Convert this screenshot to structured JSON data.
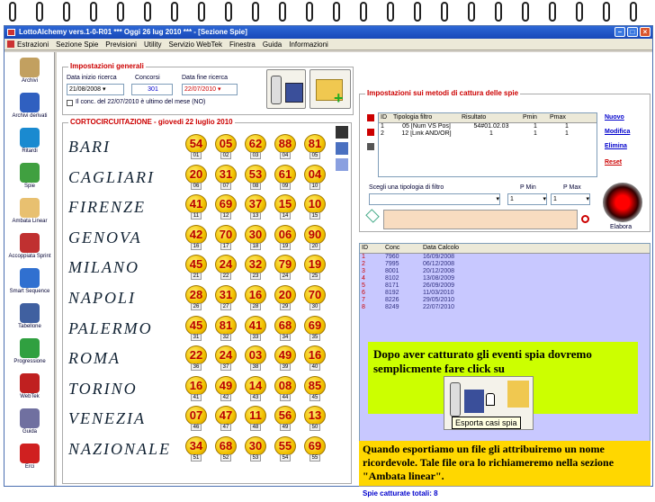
{
  "window": {
    "title": "LottoAlchemy vers.1-0-R01  ***  Oggi 26 lug 2010  ***  - [Sezione Spie]"
  },
  "menu": [
    "Estrazioni",
    "Sezione Spie",
    "Previsioni",
    "Utility",
    "Servizio WebTek",
    "Finestra",
    "Guida",
    "Informazioni"
  ],
  "sidebar": [
    {
      "label": "Archivi",
      "icon": "pencil-icon",
      "color": "#c2a060"
    },
    {
      "label": "Archivi derivati",
      "icon": "book-icon",
      "color": "#3060c0"
    },
    {
      "label": "Ritardi",
      "icon": "clock-icon",
      "color": "#1a8ad0"
    },
    {
      "label": "Spie",
      "icon": "spyglass-icon",
      "color": "#40a040"
    },
    {
      "label": "Ambata Linear",
      "icon": "letter-a-icon",
      "color": "#e8c070"
    },
    {
      "label": "Accoppiata Sprint",
      "icon": "refresh-icon",
      "color": "#c03030"
    },
    {
      "label": "Smart Sequence",
      "icon": "shield-icon",
      "color": "#3070d0"
    },
    {
      "label": "Tabellone",
      "icon": "table-icon",
      "color": "#4060a0"
    },
    {
      "label": "Progressione",
      "icon": "dollar-icon",
      "color": "#30a040"
    },
    {
      "label": "WebTek",
      "icon": "webtek-icon",
      "color": "#c02020"
    },
    {
      "label": "Guida",
      "icon": "guide-icon",
      "color": "#7070a0"
    },
    {
      "label": "Erci",
      "icon": "power-icon",
      "color": "#d02020"
    }
  ],
  "settings": {
    "title": "Impostazioni generali",
    "start_label": "Data inizio ricerca",
    "start_value": "21/08/2008",
    "concorsi_label": "Concorsi",
    "concorsi_value": "301",
    "end_label": "Data fine ricerca",
    "end_value": "22/07/2010",
    "check_label": "Il conc. del 22/07/2010 è ultimo del mese (NO)"
  },
  "draw": {
    "title": "CORTOCIRCUITAZIONE - giovedi 22 luglio 2010",
    "rows": [
      {
        "city": "BARI",
        "n": [
          "54",
          "05",
          "62",
          "88",
          "81"
        ],
        "i": [
          "01",
          "02",
          "03",
          "04",
          "05"
        ]
      },
      {
        "city": "CAGLIARI",
        "n": [
          "20",
          "31",
          "53",
          "61",
          "04"
        ],
        "i": [
          "06",
          "07",
          "08",
          "09",
          "10"
        ]
      },
      {
        "city": "FIRENZE",
        "n": [
          "41",
          "69",
          "37",
          "15",
          "10"
        ],
        "i": [
          "11",
          "12",
          "13",
          "14",
          "15"
        ]
      },
      {
        "city": "GENOVA",
        "n": [
          "42",
          "70",
          "30",
          "06",
          "90"
        ],
        "i": [
          "16",
          "17",
          "18",
          "19",
          "20"
        ]
      },
      {
        "city": "MILANO",
        "n": [
          "45",
          "24",
          "32",
          "79",
          "19"
        ],
        "i": [
          "21",
          "22",
          "23",
          "24",
          "25"
        ]
      },
      {
        "city": "NAPOLI",
        "n": [
          "28",
          "31",
          "16",
          "20",
          "70"
        ],
        "i": [
          "26",
          "27",
          "28",
          "29",
          "30"
        ]
      },
      {
        "city": "PALERMO",
        "n": [
          "45",
          "81",
          "41",
          "68",
          "69"
        ],
        "i": [
          "31",
          "32",
          "33",
          "34",
          "35"
        ]
      },
      {
        "city": "ROMA",
        "n": [
          "22",
          "24",
          "03",
          "49",
          "16"
        ],
        "i": [
          "36",
          "37",
          "38",
          "39",
          "40"
        ]
      },
      {
        "city": "TORINO",
        "n": [
          "16",
          "49",
          "14",
          "08",
          "85"
        ],
        "i": [
          "41",
          "42",
          "43",
          "44",
          "45"
        ]
      },
      {
        "city": "VENEZIA",
        "n": [
          "07",
          "47",
          "11",
          "56",
          "13"
        ],
        "i": [
          "46",
          "47",
          "48",
          "49",
          "50"
        ]
      },
      {
        "city": "NAZIONALE",
        "n": [
          "34",
          "68",
          "30",
          "55",
          "69"
        ],
        "i": [
          "51",
          "52",
          "53",
          "54",
          "55"
        ]
      }
    ]
  },
  "methods": {
    "title": "Impostazioni sui metodi di cattura delle spie",
    "headers": [
      "ID",
      "Tipologia filtro",
      "Risultato",
      "Pmin",
      "Pmax"
    ],
    "rows": [
      [
        "1",
        "05 [Num VS Pos]",
        "54#01.02.03",
        "1",
        "1"
      ],
      [
        "2",
        "12 [Link AND/OR]",
        "1",
        "1",
        "1"
      ]
    ],
    "links": [
      "Nuovo",
      "Modifica",
      "Elimina",
      "Reset"
    ],
    "select_label": "Scegli una tipologia di filtro",
    "pmin_label": "P Min",
    "pmax_label": "P Max",
    "pmin_value": "1",
    "pmax_value": "1",
    "elabora": "Elabora"
  },
  "results": {
    "headers": [
      "ID",
      "Conc",
      "Data Calcolo"
    ],
    "rows": [
      [
        "1",
        "7960",
        "16/09/2008"
      ],
      [
        "2",
        "7995",
        "06/12/2008"
      ],
      [
        "3",
        "8001",
        "20/12/2008"
      ],
      [
        "4",
        "8102",
        "13/08/2009"
      ],
      [
        "5",
        "8171",
        "26/09/2009"
      ],
      [
        "6",
        "8192",
        "11/03/2010"
      ],
      [
        "7",
        "8226",
        "29/05/2010"
      ],
      [
        "8",
        "8249",
        "22/07/2010"
      ]
    ]
  },
  "notes": {
    "green": "Dopo aver catturato gli eventi spia dovremo semplicmente fare click su",
    "tooltip": "Esporta casi spia",
    "yellow": "Quando esportiamo un file gli attribuiremo un nome ricordevole. Tale file ora lo richiameremo nella sezione \"Ambata linear\"."
  },
  "status": "Spie catturate totali: 8",
  "colors": {
    "accent": "#c00000",
    "link": "#0000cc",
    "note_green": "#ccff00",
    "note_yellow": "#ffd700",
    "grid_bg": "#c8c8ff"
  }
}
